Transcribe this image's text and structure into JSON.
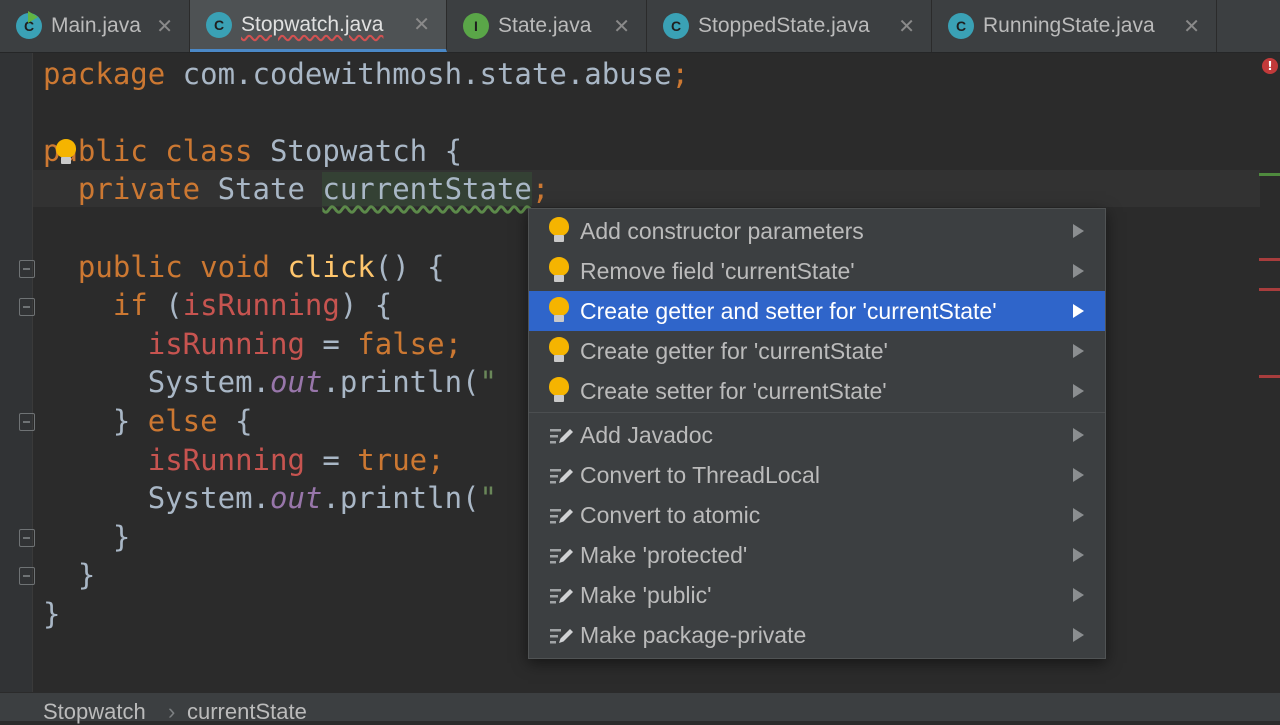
{
  "tabs": [
    {
      "label": "Main.java",
      "icon": "class-run-icon",
      "active": false
    },
    {
      "label": "Stopwatch.java",
      "icon": "class-icon",
      "active": true
    },
    {
      "label": "State.java",
      "icon": "interface-icon",
      "active": false
    },
    {
      "label": "StoppedState.java",
      "icon": "class-icon",
      "active": false
    },
    {
      "label": "RunningState.java",
      "icon": "class-icon",
      "active": false
    }
  ],
  "tab_icon_letters": {
    "class": "C",
    "interface": "I"
  },
  "close_glyph": "✕",
  "code": {
    "l1_kw": "package",
    "l1_rest": " com.codewithmosh.state.abuse",
    "l1_semi": ";",
    "l3_kw": "public class",
    "l3_rest": " Stopwatch {",
    "l4_kw": "private",
    "l4_type": " State ",
    "l4_var": "currentState",
    "l4_semi": ";",
    "l6_kw": "public void",
    "l6_fn": "click",
    "l6_rest": "() {",
    "l7_kw": "if",
    "l7_open": " (",
    "l7_fld": "isRunning",
    "l7_close": ") {",
    "l8_fld": "isRunning",
    "l8_eq": " = ",
    "l8_kw": "false",
    "l8_semi": ";",
    "l9_a": "System.",
    "l9_st": "out",
    "l9_b": ".println(",
    "l9_str": "\"",
    "l10_a": "} ",
    "l10_kw": "else",
    "l10_b": " {",
    "l11_fld": "isRunning",
    "l11_eq": " = ",
    "l11_kw": "true",
    "l11_semi": ";",
    "l12_a": "System.",
    "l12_st": "out",
    "l12_b": ".println(",
    "l12_str": "\"",
    "l13": "}",
    "l14": "}",
    "l15": "}"
  },
  "popup": {
    "items": [
      {
        "label": "Add constructor parameters",
        "icon": "bulb-icon"
      },
      {
        "label": "Remove field 'currentState'",
        "icon": "bulb-icon"
      },
      {
        "label": "Create getter and setter for 'currentState'",
        "icon": "bulb-icon",
        "selected": true
      },
      {
        "label": "Create getter for 'currentState'",
        "icon": "bulb-icon"
      },
      {
        "label": "Create setter for 'currentState'",
        "icon": "bulb-icon"
      },
      {
        "label": "Add Javadoc",
        "icon": "edit-icon"
      },
      {
        "label": "Convert to ThreadLocal",
        "icon": "edit-icon"
      },
      {
        "label": "Convert to atomic",
        "icon": "edit-icon"
      },
      {
        "label": "Make 'protected'",
        "icon": "edit-icon"
      },
      {
        "label": "Make 'public'",
        "icon": "edit-icon"
      },
      {
        "label": "Make package-private",
        "icon": "edit-icon"
      }
    ]
  },
  "error_indicator": "!",
  "breadcrumb": {
    "items": [
      "Stopwatch",
      "currentState"
    ],
    "separator": "›"
  },
  "colors": {
    "selection": "#2f65ca",
    "keyword": "#cc7832",
    "field": "#c75450",
    "method": "#ffc66d",
    "bulb": "#f5b400"
  }
}
